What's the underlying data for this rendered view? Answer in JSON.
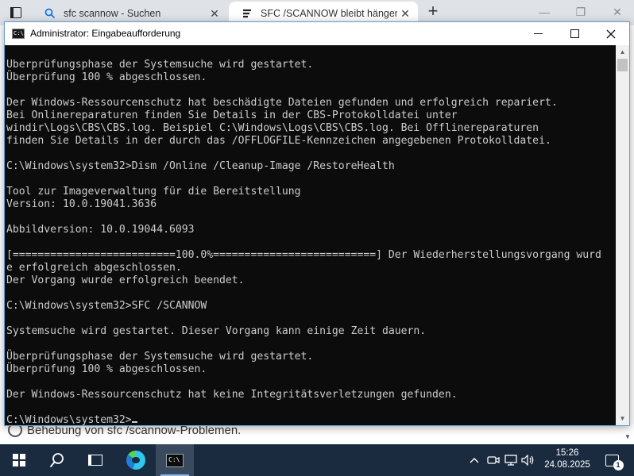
{
  "browser": {
    "tabs": [
      {
        "title": "sfc scannow - Suchen",
        "icon": "search-icon",
        "close": "✕"
      },
      {
        "title": "SFC /SCANNOW bleibt hängen u",
        "icon": "site-icon",
        "close": "✕"
      }
    ],
    "new_tab": "+",
    "page_text": "Behebung von sfc /scannow-Problemen."
  },
  "console": {
    "title": "Administrator: Eingabeaufforderung",
    "lines": [
      "Überprüfungsphase der Systemsuche wird gestartet.",
      "Überprüfung 100 % abgeschlossen.",
      "",
      "Der Windows-Ressourcenschutz hat beschädigte Dateien gefunden und erfolgreich repariert.",
      "Bei Onlinereparaturen finden Sie Details in der CBS-Protokolldatei unter",
      "windir\\Logs\\CBS\\CBS.log. Beispiel C:\\Windows\\Logs\\CBS\\CBS.log. Bei Offlinereparaturen",
      "finden Sie Details in der durch das /OFFLOGFILE-Kennzeichen angegebenen Protokolldatei.",
      "",
      "C:\\Windows\\system32>Dism /Online /Cleanup-Image /RestoreHealth",
      "",
      "Tool zur Imageverwaltung für die Bereitstellung",
      "Version: 10.0.19041.3636",
      "",
      "Abbildversion: 10.0.19044.6093",
      "",
      "[==========================100.0%==========================] Der Wiederherstellungsvorgang wurd",
      "e erfolgreich abgeschlossen.",
      "Der Vorgang wurde erfolgreich beendet.",
      "",
      "C:\\Windows\\system32>SFC /SCANNOW",
      "",
      "Systemsuche wird gestartet. Dieser Vorgang kann einige Zeit dauern.",
      "",
      "Überprüfungsphase der Systemsuche wird gestartet.",
      "Überprüfung 100 % abgeschlossen.",
      "",
      "Der Windows-Ressourcenschutz hat keine Integritätsverletzungen gefunden.",
      ""
    ],
    "prompt": "C:\\Windows\\system32>"
  },
  "taskbar": {
    "time": "15:26",
    "date": "24.08.2025",
    "notification_count": "1"
  }
}
